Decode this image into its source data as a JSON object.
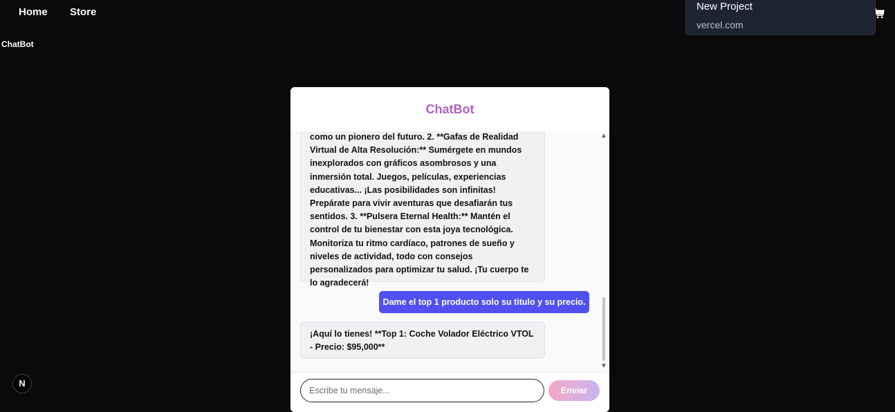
{
  "nav": {
    "home_label": "Home",
    "store_label": "Store"
  },
  "page": {
    "title": "ChatBot"
  },
  "popup": {
    "title": "New Project",
    "subtitle": "vercel.com"
  },
  "chat": {
    "header": "ChatBot",
    "messages": [
      {
        "role": "bot",
        "text": "como un pionero del futuro. 2. **Gafas de Realidad Virtual de Alta Resolución:** Sumérgete en mundos inexplorados con gráficos asombrosos y una inmersión total. Juegos, películas, experiencias educativas... ¡Las posibilidades son infinitas! Prepárate para vivir aventuras que desafiarán tus sentidos. 3. **Pulsera Eternal Health:** Mantén el control de tu bienestar con esta joya tecnológica. Monitoriza tu ritmo cardíaco, patrones de sueño y niveles de actividad, todo con consejos personalizados para optimizar tu salud. ¡Tu cuerpo te lo agradecerá!"
      },
      {
        "role": "user",
        "text": "Dame el top 1 producto solo su titulo y su precio."
      },
      {
        "role": "bot",
        "text": "¡Aquí lo tienes! **Top 1: Coche Volador Eléctrico VTOL - Precio: $95,000**"
      }
    ],
    "input_placeholder": "Escribe tu mensaje...",
    "input_value": "",
    "send_label": "Enviar"
  },
  "badge": {
    "letter": "N"
  },
  "icons": {
    "cart": "cart-icon",
    "scroll_up": "chevron-up-icon",
    "scroll_down": "chevron-down-icon"
  },
  "colors": {
    "header": "#b061c4",
    "user_bubble": "#5050f0",
    "send_gradient_start": "#f3a8c5",
    "send_gradient_end": "#c9b4f2"
  }
}
